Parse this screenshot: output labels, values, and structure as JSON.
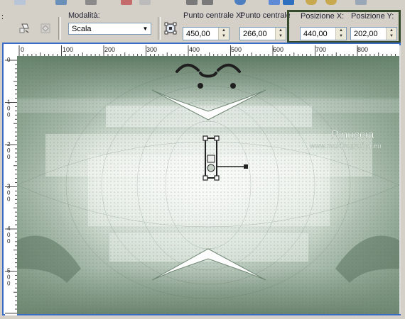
{
  "toolbar": {
    "colon": ":",
    "mode_label": "Modalità:",
    "mode_value": "Scala",
    "cx_label": "Punto centrale X:",
    "cy_label": "Punto centrale Y:",
    "px_label": "Posizione X:",
    "py_label": "Posizione Y:",
    "cx_value": "450,00",
    "cy_value": "266,00",
    "px_value": "440,00",
    "py_value": "202,00"
  },
  "ruler": {
    "h_ticks": [
      "0",
      "100",
      "200",
      "300",
      "400",
      "500",
      "600",
      "700",
      "800"
    ],
    "v_ticks": [
      "0",
      "100",
      "200",
      "300",
      "400",
      "500"
    ]
  },
  "canvas": {
    "watermark_title": "Pinuccia",
    "watermark_url": "www.maidiregrafica.eu"
  },
  "colors": {
    "highlight_border": "#364a2c",
    "doc_border": "#3a6cc7",
    "canvas_base": "#c9d6cb",
    "canvas_dark": "#4f6a55"
  }
}
